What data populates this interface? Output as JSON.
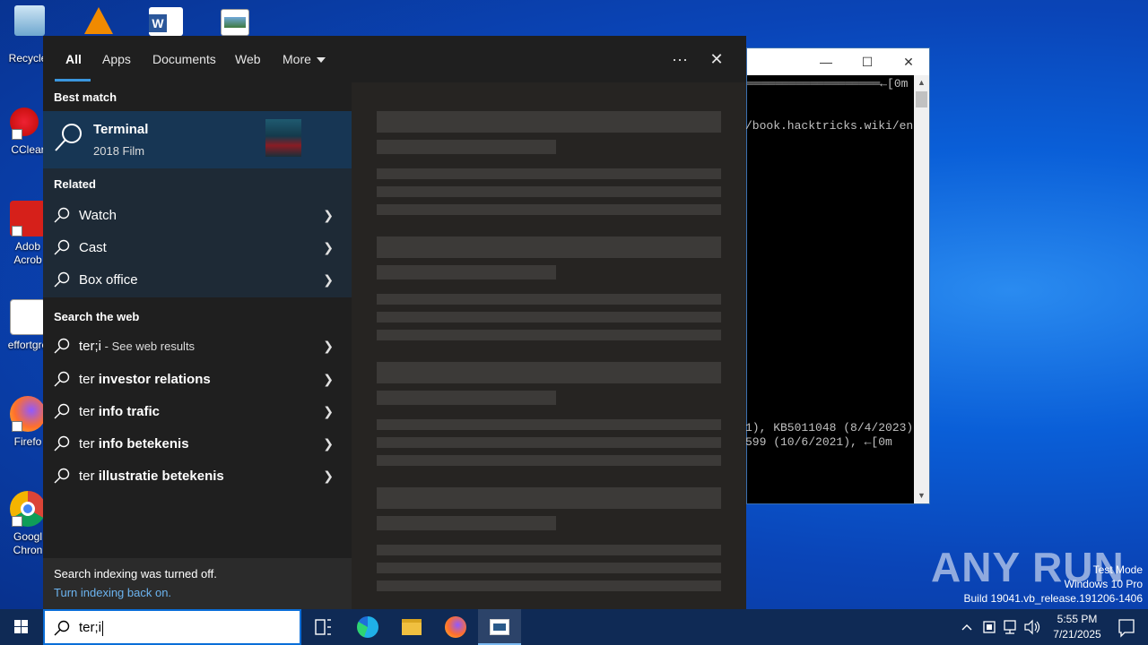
{
  "desktop": {
    "icons": [
      {
        "label": "Recycle"
      },
      {
        "label": "CClear"
      },
      {
        "label": "Adob\nAcrob"
      },
      {
        "label": "effortgre"
      },
      {
        "label": "Firefo"
      },
      {
        "label": "Googl\nChron"
      }
    ]
  },
  "terminal": {
    "lines": [
      "═══════════════════←[0m",
      "/book.hacktricks.wiki/en",
      "1), KB5011048 (8/4/2023)",
      "599 (10/6/2021), ←[0m"
    ]
  },
  "search_panel": {
    "tabs": [
      {
        "label": "All",
        "active": true
      },
      {
        "label": "Apps"
      },
      {
        "label": "Documents"
      },
      {
        "label": "Web"
      },
      {
        "label": "More"
      }
    ],
    "more_options_glyph": "···",
    "close_glyph": "✕",
    "best_match": {
      "heading": "Best match",
      "title": "Terminal",
      "subtitle": "2018 Film"
    },
    "related": {
      "heading": "Related",
      "items": [
        "Watch",
        "Cast",
        "Box office"
      ]
    },
    "web": {
      "heading": "Search the web",
      "first": {
        "query": "ter;i",
        "suffix": " - See web results"
      },
      "suggestions": [
        {
          "prefix": "ter ",
          "bold": "investor relations"
        },
        {
          "prefix": "ter ",
          "bold": "info trafic"
        },
        {
          "prefix": "ter ",
          "bold": "info betekenis"
        },
        {
          "prefix": "ter ",
          "bold": "illustratie betekenis"
        }
      ]
    },
    "indexing": {
      "message": "Search indexing was turned off.",
      "link": "Turn indexing back on."
    }
  },
  "watermark": {
    "brand": "ANY RUN",
    "line1": "Test Mode",
    "line2": "Windows 10 Pro",
    "line3": "Build 19041.vb_release.191206-1406"
  },
  "taskbar": {
    "search_query": "ter;i",
    "clock_time": "5:55 PM",
    "clock_date": "7/21/2025"
  },
  "colors": {
    "accent": "#3a96dd",
    "best_match_bg": "#173654",
    "related_bg": "#1e2a36",
    "panel_bg": "#1f1f1f",
    "link": "#6cb4f0"
  }
}
